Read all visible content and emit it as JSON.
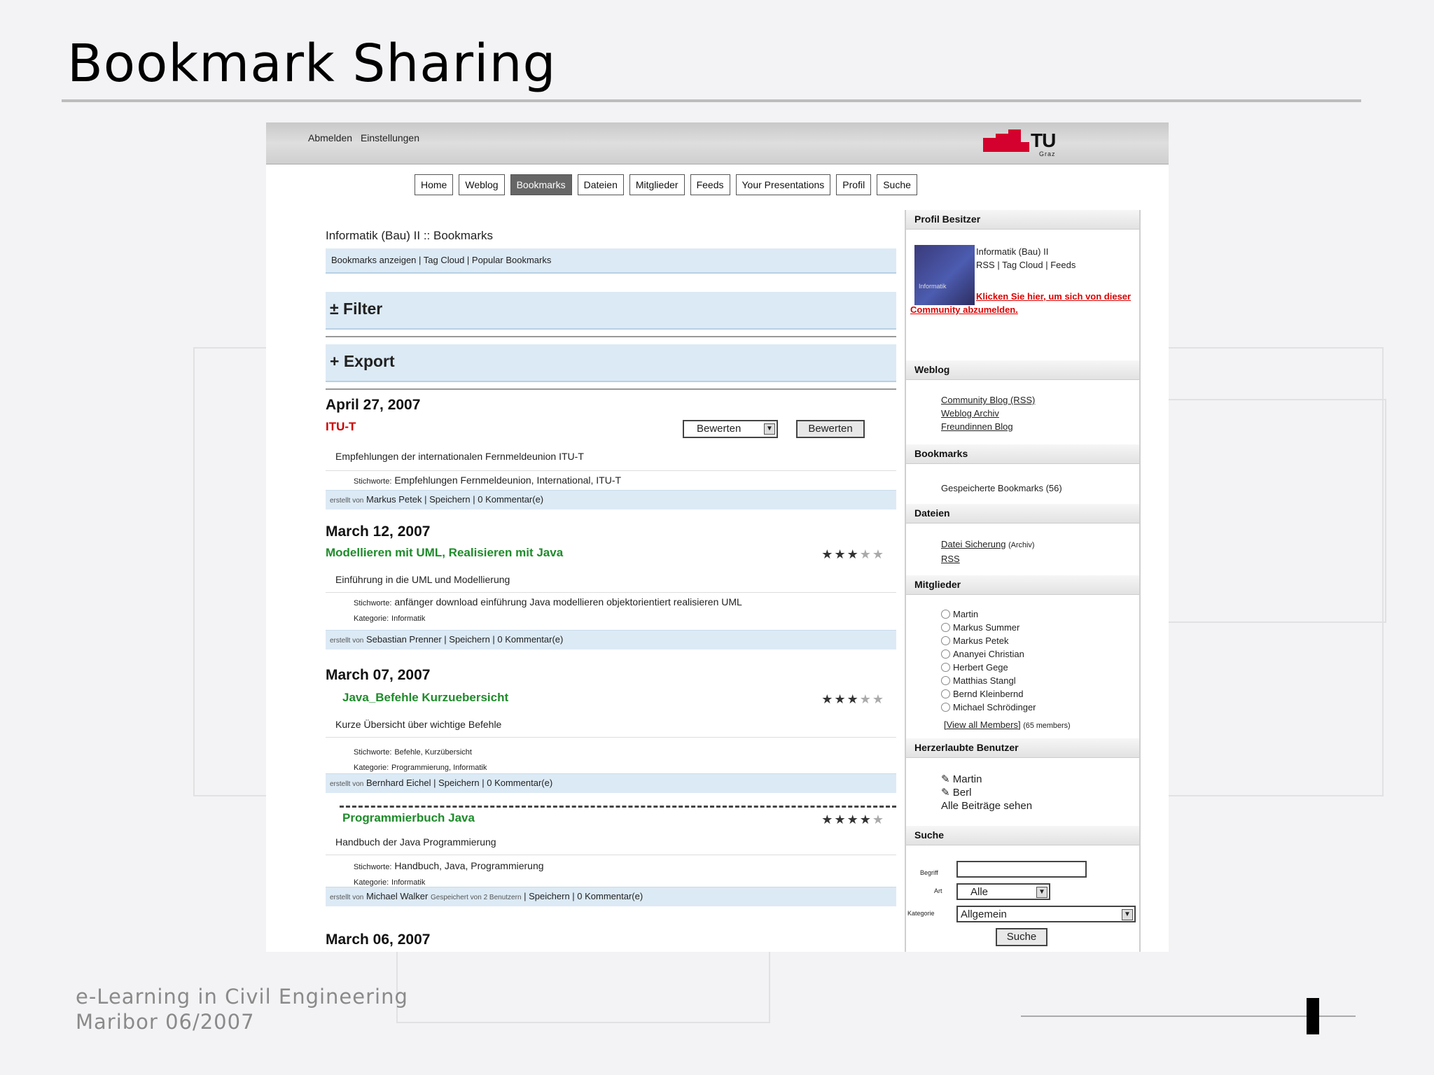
{
  "slide": {
    "title": "Bookmark Sharing",
    "footer_line1": "e-Learning in Civil Engineering",
    "footer_line2": "Maribor 06/2007"
  },
  "topbar": {
    "logout": "Abmelden",
    "settings": "Einstellungen",
    "logo_text": "TU",
    "logo_sub": "Graz"
  },
  "nav": {
    "tabs": [
      "Home",
      "Weblog",
      "Bookmarks",
      "Dateien",
      "Mitglieder",
      "Feeds",
      "Your Presentations",
      "Profil",
      "Suche"
    ],
    "active_index": 2
  },
  "main": {
    "breadcrumb": "Informatik (Bau) II :: Bookmarks",
    "linkbar": "Bookmarks anzeigen | Tag Cloud | Popular Bookmarks",
    "filter_label": "± Filter",
    "export_label": "+ Export",
    "rate_select": "Bewerten",
    "rate_button": "Bewerten",
    "groups": [
      {
        "date": "April 27, 2007"
      },
      {
        "date": "March 12, 2007"
      },
      {
        "date": "March 07, 2007"
      },
      {
        "date": "March 06, 2007"
      }
    ],
    "entries": [
      {
        "title": "ITU-T",
        "description": "Empfehlungen der internationalen Fernmeldeunion ITU-T",
        "tags_label": "Stichworte:",
        "tags": "Empfehlungen Fernmeldeunion, International, ITU-T",
        "meta_by": "erstellt von",
        "author": "Markus Petek",
        "actions": "| Speichern | 0 Kommentar(e)"
      },
      {
        "title": "Modellieren mit UML, Realisieren mit Java",
        "rating": 3,
        "description": "Einführung in die UML und Modellierung",
        "tags_label": "Stichworte:",
        "tags": "anfänger download einführung Java modellieren objektorientiert realisieren UML",
        "category_label": "Kategorie:",
        "category": "Informatik",
        "meta_by": "erstellt von",
        "author": "Sebastian Prenner",
        "actions": "| Speichern | 0 Kommentar(e)"
      },
      {
        "title": "Java_Befehle Kurzuebersicht",
        "rating": 3,
        "description": "Kurze Übersicht über wichtige Befehle",
        "tags_label": "Stichworte:",
        "tags": "Befehle, Kurzübersicht",
        "category_label": "Kategorie:",
        "category": "Programmierung, Informatik",
        "meta_by": "erstellt von",
        "author": "Bernhard Eichel",
        "actions": "| Speichern | 0 Kommentar(e)"
      },
      {
        "title": "Programmierbuch Java",
        "rating": 4,
        "description": "Handbuch der Java Programmierung",
        "tags_label": "Stichworte:",
        "tags": "Handbuch, Java, Programmierung",
        "category_label": "Kategorie:",
        "category": "Informatik",
        "meta_by": "erstellt von",
        "author": "Michael Walker",
        "note": "Gespeichert von 2 Benutzern",
        "actions": "| Speichern | 0 Kommentar(e)"
      }
    ]
  },
  "sidebar": {
    "profile": {
      "heading": "Profil Besitzer",
      "name": "Informatik (Bau) II",
      "links": "RSS | Tag Cloud | Feeds",
      "join_text": "Klicken Sie hier, um sich von dieser Community abzumelden.",
      "avatar_text": "Informatik"
    },
    "weblog": {
      "heading": "Weblog",
      "links": [
        "Community Blog (RSS)",
        "Weblog Archiv",
        "Freundinnen Blog"
      ]
    },
    "bookmarks": {
      "heading": "Bookmarks",
      "text": "Gespeicherte Bookmarks (56)"
    },
    "files": {
      "heading": "Dateien",
      "links": [
        "Datei Sicherung",
        "RSS"
      ],
      "note": "(Archiv)"
    },
    "members": {
      "heading": "Mitglieder",
      "names": [
        "Martin",
        "Markus Summer",
        "Markus Petek",
        "Ananyei Christian",
        "Herbert Gege",
        "Matthias Stangl",
        "Bernd Kleinbernd",
        "Michael Schrödinger"
      ],
      "view_all": "[View all Members]",
      "view_all_note": "(65 members)"
    },
    "contacts": {
      "heading": "Herzerlaubte Benutzer",
      "names": [
        "Martin",
        "Berl"
      ],
      "all_posts": "Alle Beiträge sehen"
    },
    "search": {
      "heading": "Suche",
      "label_term": "Begriff",
      "label_type": "Art",
      "type_value": "Alle",
      "label_category": "Kategorie",
      "category_value": "Allgemein",
      "button": "Suche"
    }
  }
}
